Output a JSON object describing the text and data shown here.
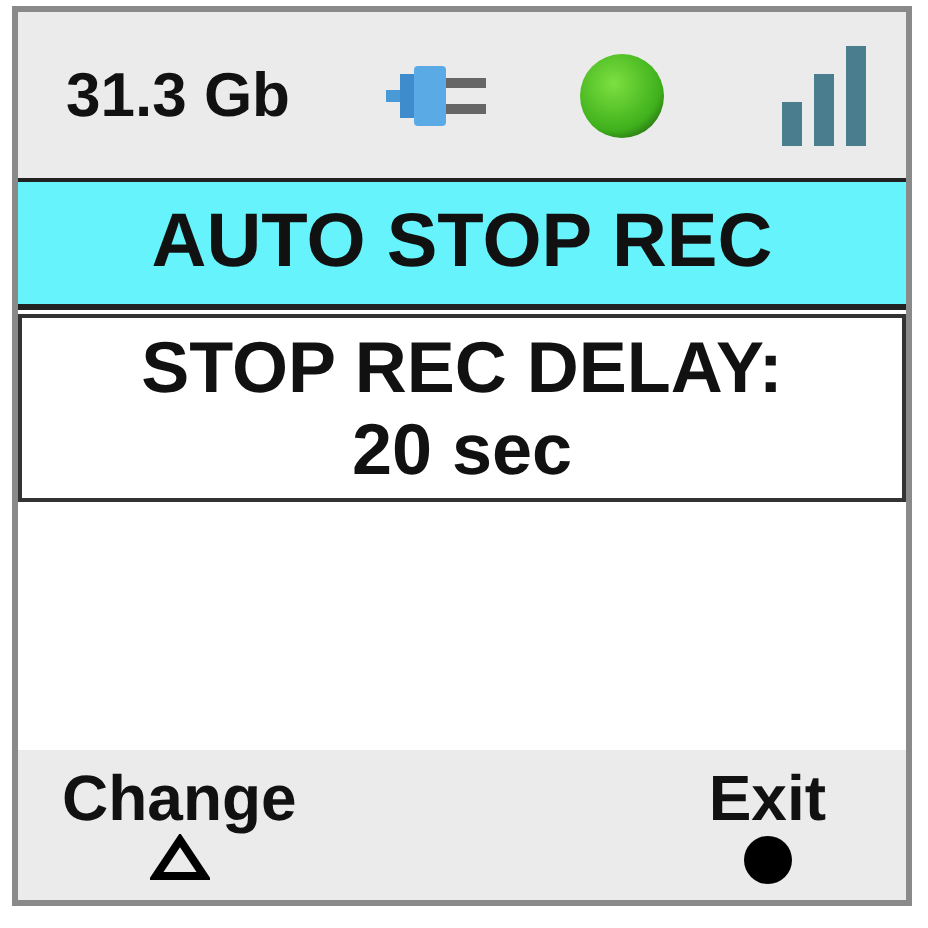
{
  "status_bar": {
    "storage": "31.3 Gb"
  },
  "header": {
    "title": "AUTO STOP REC"
  },
  "setting": {
    "label": "STOP REC DELAY:",
    "value": "20 sec"
  },
  "soft_keys": [
    {
      "label": "Change",
      "kind": "triangle"
    },
    {
      "label": "Exit",
      "kind": "circle"
    }
  ]
}
